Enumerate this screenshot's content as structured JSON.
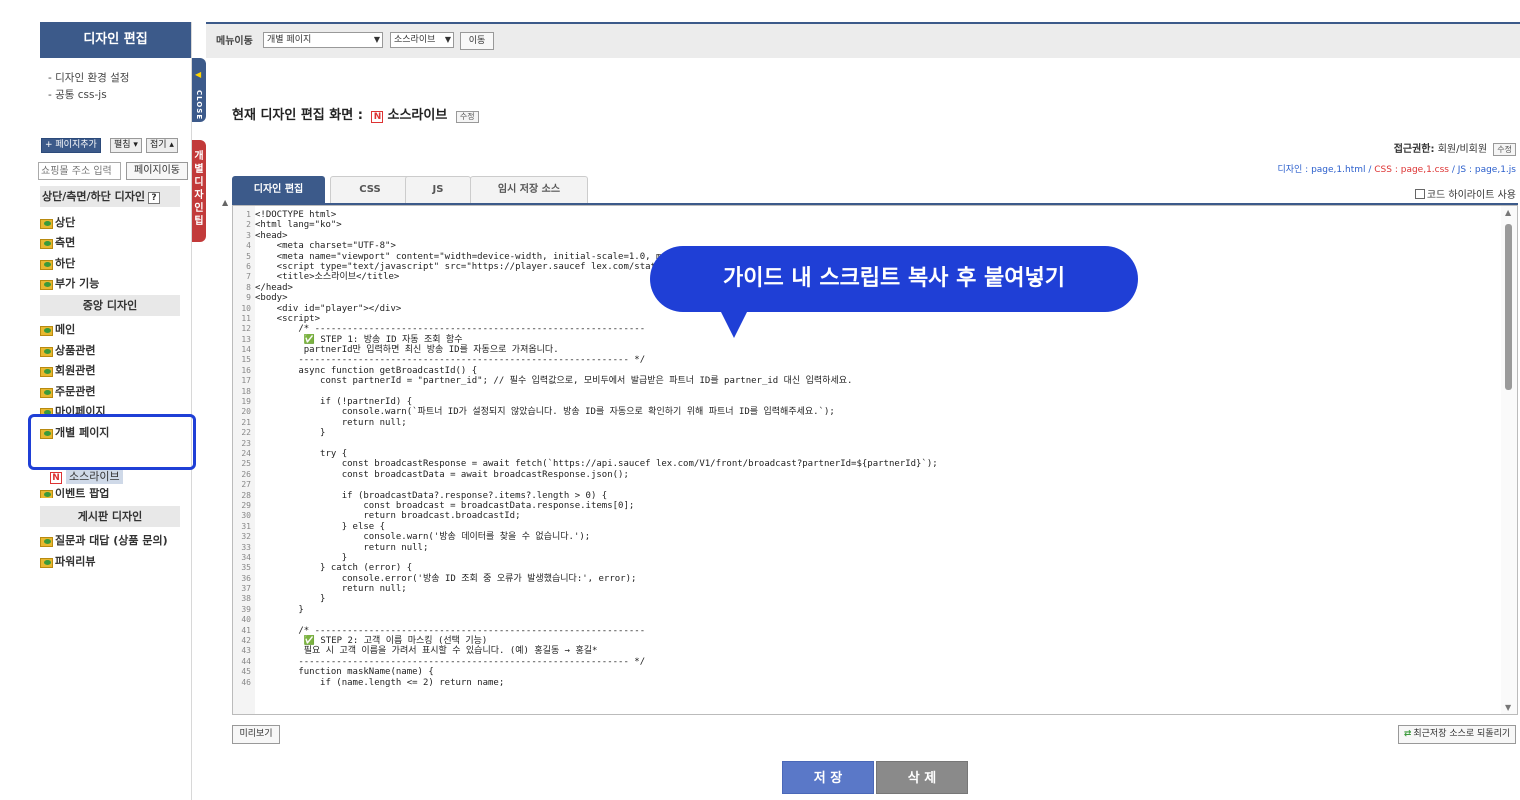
{
  "sidebar": {
    "title": "디자인 편집",
    "env_links": [
      "- 디자인 환경 설정",
      "- 공통 css-js"
    ],
    "tools": {
      "add": "+ 페이지추가",
      "edit": "펼침 ▾",
      "fold": "접기 ▴"
    },
    "url_placeholder": "쇼핑몰 주소 입력",
    "page_move": "페이지이동",
    "sections": {
      "top": "상단/측면/하단 디자인",
      "top_help": "?",
      "center": "중앙 디자인",
      "board": "게시판 디자인"
    },
    "top_items": [
      "상단",
      "측면",
      "하단",
      "부가 기능"
    ],
    "center_items": [
      "메인",
      "상품관련",
      "회원관련",
      "주문관련",
      "마이페이지",
      "개별 페이지",
      "이벤트 팝업"
    ],
    "sub_item": "소스라이브",
    "board_items": [
      "질문과 대답 (상품 문의)",
      "파워리뷰"
    ],
    "close_tab": "CLOSE",
    "guide_tab": "개별디자인팁"
  },
  "topbar": {
    "label": "메뉴이동",
    "page_select": "개별 페이지",
    "sub_select": "소스라이브",
    "go": "이동"
  },
  "current": {
    "label": "현재 디자인 편집 화면 :",
    "page_name": "소스라이브",
    "modify": "수정"
  },
  "access": {
    "label": "접근권한:",
    "value": "회원/비회원",
    "modify": "수정",
    "design_file": "디자인 : page,1.html",
    "css_file": "CSS : page,1.css",
    "js_file": "JS : page,1.js",
    "sep": " / "
  },
  "tabs": [
    "디자인 편집",
    "CSS",
    "JS",
    "임시 저장 소스"
  ],
  "highlight_toggle": "코드 하이라이트 사용",
  "code": [
    "<!DOCTYPE html>",
    "<html lang=\"ko\">",
    "<head>",
    "    <meta charset=\"UTF-8\">",
    "    <meta name=\"viewport\" content=\"width=device-width, initial-scale=1.0, maximum-sc",
    "    <script type=\"text/javascript\" src=\"https://player.saucef lex.com/static/js/Sauc",
    "    <title>소스라이브</title>",
    "</head>",
    "<body>",
    "    <div id=\"player\"></div>",
    "    <script>",
    "        /* -------------------------------------------------------------",
    "         ✅ STEP 1: 방송 ID 자동 조회 함수",
    "         partnerId만 입력하면 최신 방송 ID를 자동으로 가져옵니다.",
    "        ------------------------------------------------------------- */",
    "        async function getBroadcastId() {",
    "            const partnerId = \"partner_id\"; // 필수 입력값으로, 모비두에서 발급받은 파트너 ID를 partner_id 대신 입력하세요.",
    "",
    "            if (!partnerId) {",
    "                console.warn(`파트너 ID가 설정되지 않았습니다. 방송 ID를 자동으로 확인하기 위해 파트너 ID를 입력해주세요.`);",
    "                return null;",
    "            }",
    "",
    "            try {",
    "                const broadcastResponse = await fetch(`https://api.saucef lex.com/V1/front/broadcast?partnerId=${partnerId}`);",
    "                const broadcastData = await broadcastResponse.json();",
    "",
    "                if (broadcastData?.response?.items?.length > 0) {",
    "                    const broadcast = broadcastData.response.items[0];",
    "                    return broadcast.broadcastId;",
    "                } else {",
    "                    console.warn('방송 데이터를 찾을 수 없습니다.');",
    "                    return null;",
    "                }",
    "            } catch (error) {",
    "                console.error('방송 ID 조회 중 오류가 발생했습니다:', error);",
    "                return null;",
    "            }",
    "        }",
    "",
    "        /* -------------------------------------------------------------",
    "         ✅ STEP 2: 고객 이름 마스킹 (선택 기능)",
    "         필요 시 고객 이름을 가려서 표시할 수 있습니다. (예) 홍길동 → 홍길*",
    "        ------------------------------------------------------------- */",
    "        function maskName(name) {",
    "            if (name.length <= 2) return name;"
  ],
  "callout": "가이드 내 스크립트 복사 후 붙여넣기",
  "bottom": {
    "preview": "미리보기",
    "restore": "최근저장 소스로 되돌리기",
    "save": "저 장",
    "delete": "삭 제"
  }
}
